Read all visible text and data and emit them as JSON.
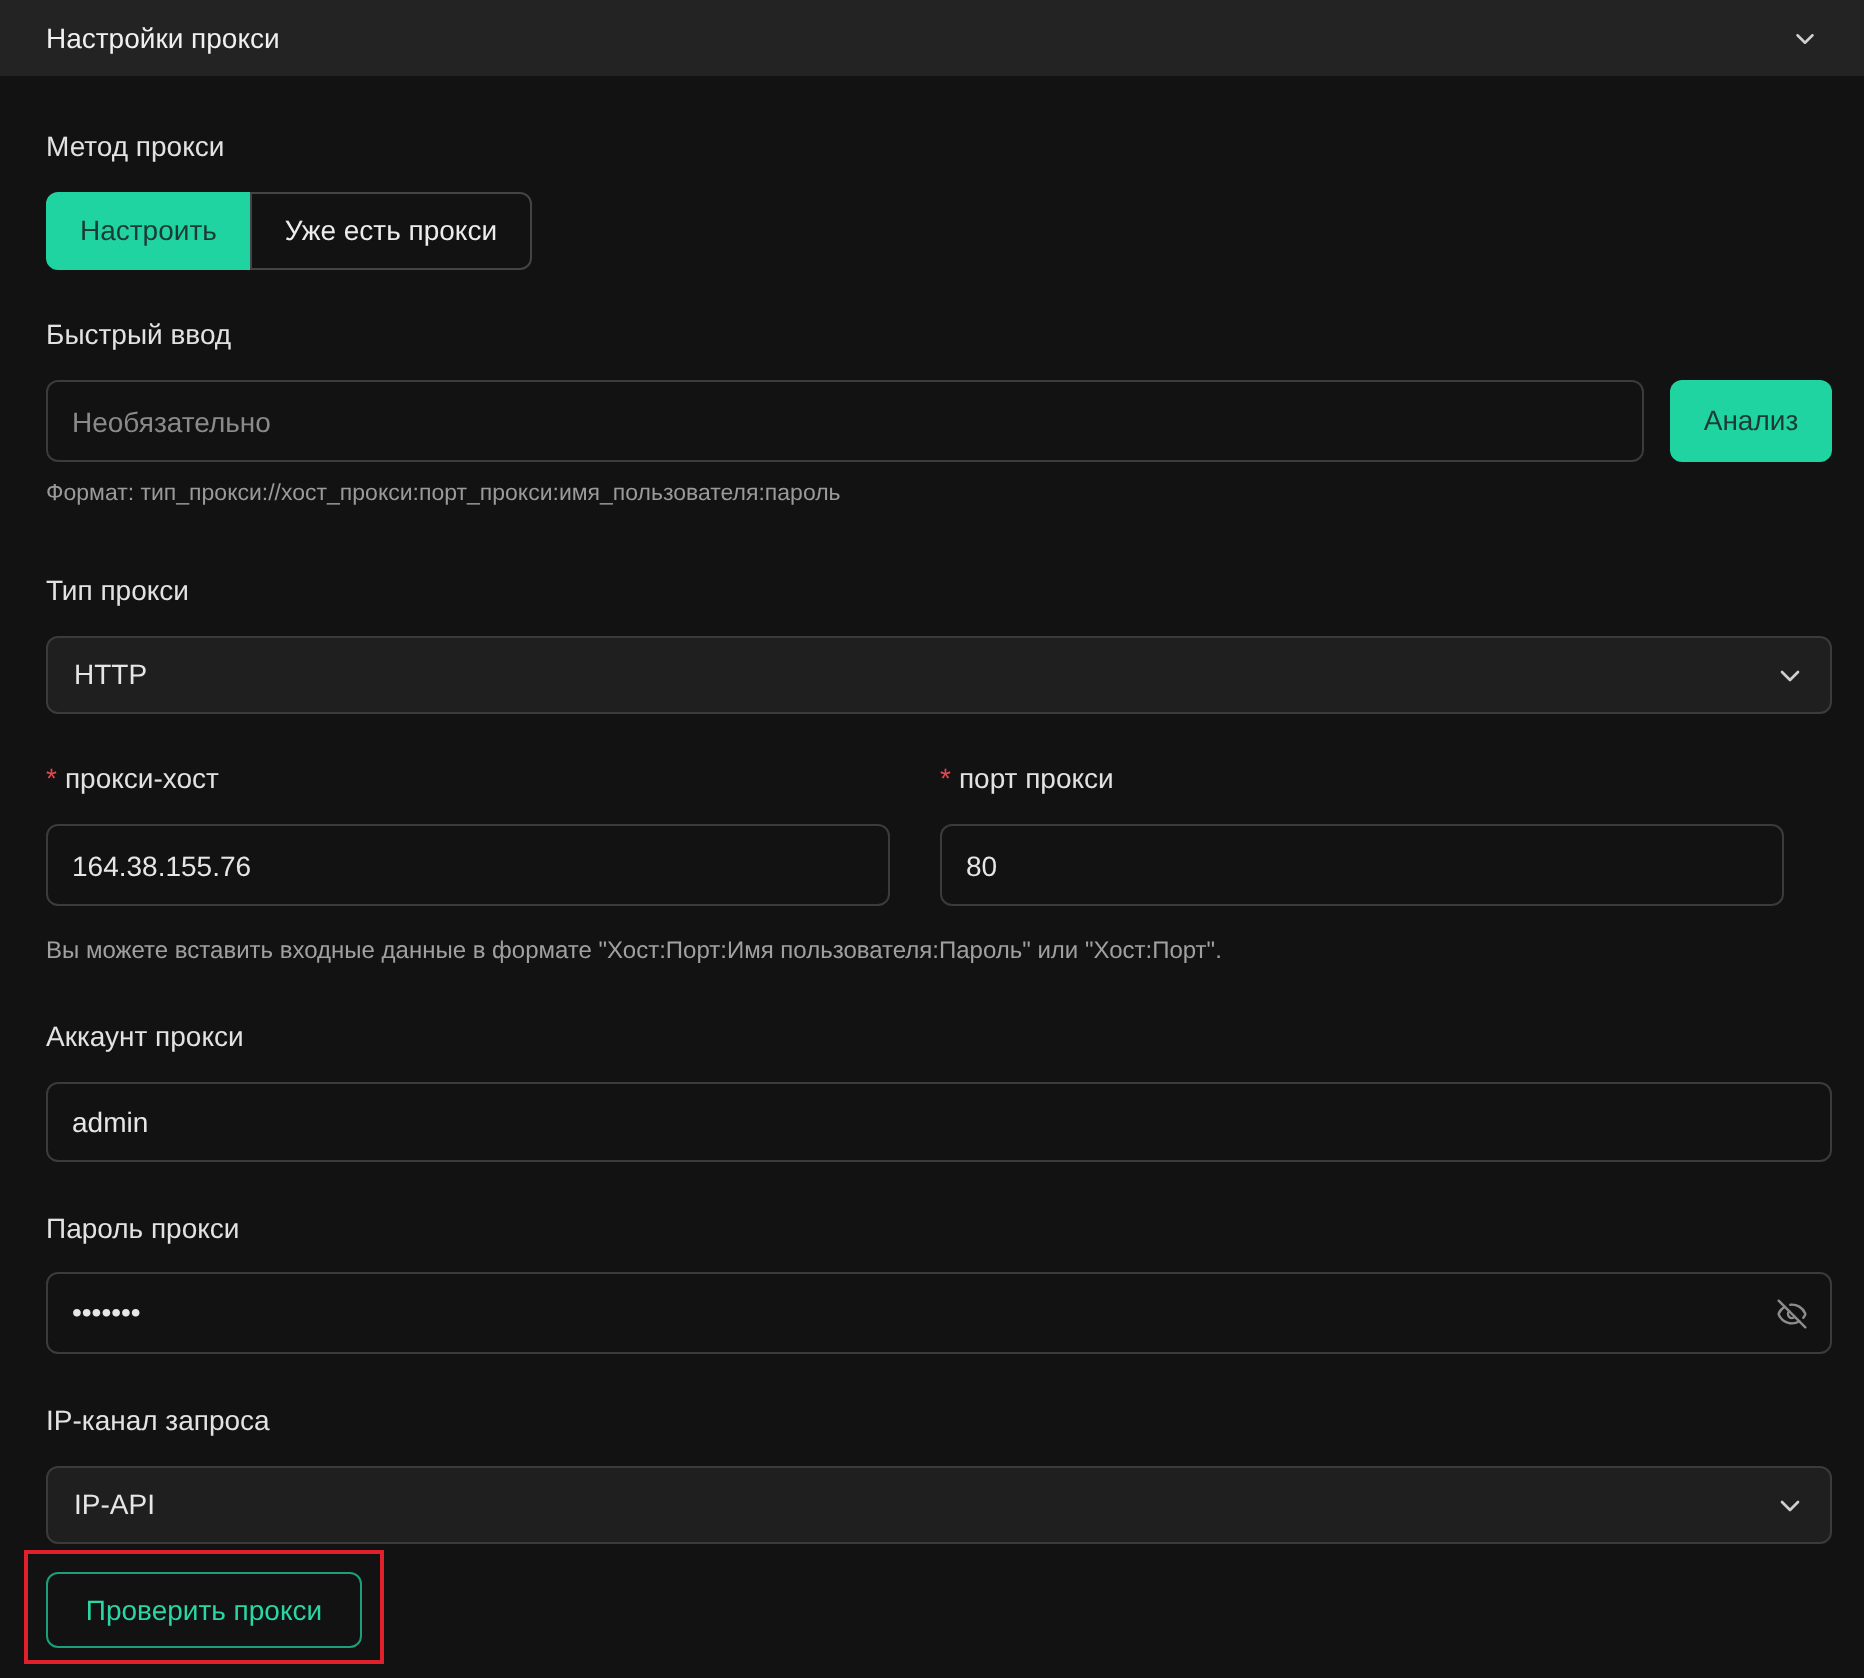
{
  "panel": {
    "title": "Настройки прокси",
    "expanded": true
  },
  "proxy_method": {
    "label": "Метод прокси",
    "options": [
      {
        "label": "Настроить",
        "selected": true
      },
      {
        "label": "Уже есть прокси",
        "selected": false
      }
    ]
  },
  "quick_input": {
    "label": "Быстрый ввод",
    "placeholder": "Необязательно",
    "button": "Анализ",
    "hint": "Формат: тип_прокси://хост_прокси:порт_прокси:имя_пользователя:пароль"
  },
  "proxy_type": {
    "label": "Тип прокси",
    "value": "HTTP"
  },
  "address": [
    {
      "required_mark": "*",
      "label": "прокси-хост",
      "value": "164.38.155.76"
    },
    {
      "required_mark": "*",
      "label": "порт прокси",
      "value": "80"
    }
  ],
  "address_hint": "Вы можете вставить входные данные в формате \"Хост:Порт:Имя пользователя:Пароль\" или \"Хост:Порт\".",
  "account": {
    "label": "Аккаунт прокси",
    "value": "admin"
  },
  "password": {
    "label": "Пароль прокси",
    "value": "•••••••",
    "revealed": false
  },
  "ip_channel": {
    "label": "IP-канал запроса",
    "value": "IP-API"
  },
  "check_button": {
    "label": "Проверить прокси",
    "highlighted": true
  }
}
